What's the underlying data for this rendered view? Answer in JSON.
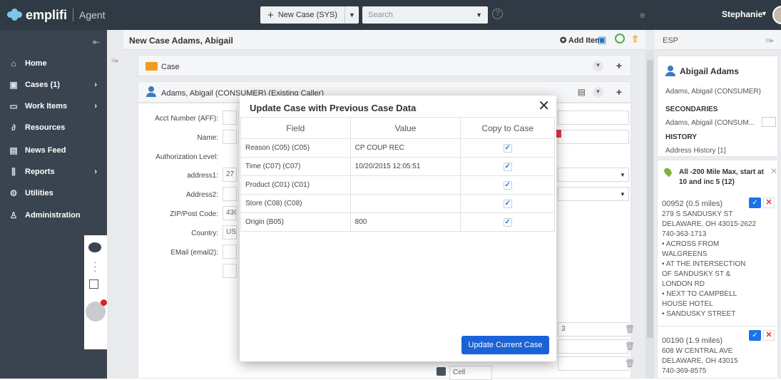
{
  "app": {
    "brand": "emplifi",
    "product": "Agent"
  },
  "topbar": {
    "new_case_label": "New Case (SYS)",
    "search_placeholder": "Search",
    "help": "?",
    "user_name": "Stephanie"
  },
  "nav": {
    "items": [
      {
        "label": "Home",
        "icon": "home-icon"
      },
      {
        "label": "Cases (1)",
        "icon": "cases-icon",
        "arrow": "›"
      },
      {
        "label": "Work Items",
        "icon": "work-items-icon",
        "arrow": "›"
      },
      {
        "label": "Resources",
        "icon": "resources-icon"
      },
      {
        "label": "News Feed",
        "icon": "news-feed-icon"
      },
      {
        "label": "Reports",
        "icon": "reports-icon",
        "arrow": "›"
      },
      {
        "label": "Utilities",
        "icon": "utilities-icon"
      },
      {
        "label": "Administration",
        "icon": "administration-icon"
      }
    ]
  },
  "main": {
    "title": "New Case Adams, Abigail",
    "add_item": "Add Item",
    "case_panel_title": "Case",
    "consumer_panel_title": "Adams, Abigail (CONSUMER) (Existing Caller)"
  },
  "form": {
    "acct_number_label": "Acct Number (AFF):",
    "name_label": "Name:",
    "auth_level_label": "Authorization Level:",
    "address1_label": "address1:",
    "address1_value": "27 F",
    "address2_label": "Address2:",
    "zip_label": "ZIP/Post Code:",
    "zip_value": "430",
    "country_label": "Country:",
    "country_value": "USA",
    "email_label": "EMail (email2):",
    "phone_value_fragment": "3",
    "phone_type": "Cell"
  },
  "modal": {
    "title": "Update Case with Previous Case Data",
    "columns": [
      "Field",
      "Value",
      "Copy to Case"
    ],
    "rows": [
      {
        "field": "Reason (C05) (C05)",
        "value": "CP COUP REC",
        "checked": true
      },
      {
        "field": "Time (C07) (C07)",
        "value": "10/20/2015 12:05:51",
        "checked": true
      },
      {
        "field": "Product (C01) (C01)",
        "value": "",
        "checked": true
      },
      {
        "field": "Store (C08) (C08)",
        "value": "",
        "checked": true
      },
      {
        "field": "Origin (B05)",
        "value": "800",
        "checked": true
      }
    ],
    "update_button": "Update Current Case"
  },
  "right": {
    "header": "ESP",
    "contact_name": "Abigail Adams",
    "contact_sub": "Adams, Abigail (CONSUMER)",
    "secondaries_label": "SECONDARIES",
    "secondary_value": "Adams, Abigail (CONSUM...",
    "history_label": "HISTORY",
    "history_value": "Address History [1]",
    "store_search_title": "All -200 Mile Max, start at 10 and inc 5 (12)",
    "stores": [
      {
        "id": "00952 (0.5 miles)",
        "lines": [
          "279 S SANDUSKY ST",
          "DELAWARE, OH 43015-2622",
          "740-363-1713",
          "• ACROSS FROM",
          "WALGREENS",
          "• AT THE INTERSECTION",
          "OF SANDUSKY ST &",
          "LONDON RD",
          "• NEXT TO CAMPBELL",
          "HOUSE HOTEL",
          "• SANDUSKY STREET"
        ]
      },
      {
        "id": "00190 (1.9 miles)",
        "lines": [
          "608 W CENTRAL AVE",
          "DELAWARE, OH 43015",
          "740-369-8575"
        ]
      }
    ]
  },
  "colors": {
    "topbar": "#2f3a44",
    "nav": "#3a4450",
    "primary_button": "#1a62d6",
    "accent_orange": "#f29c1f",
    "alert_red": "#e21e26"
  }
}
